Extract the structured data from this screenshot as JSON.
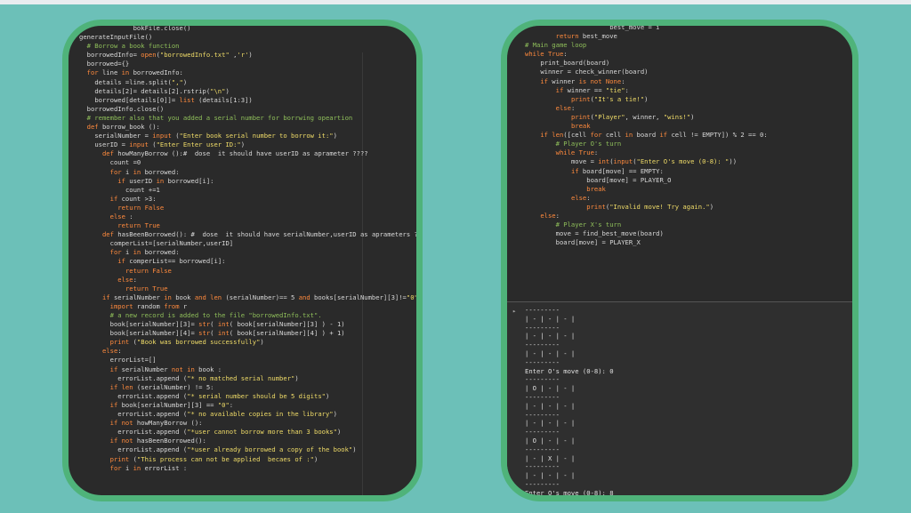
{
  "left_editor": {
    "lines": [
      {
        "t": "              bokFile.close()",
        "c": "code"
      },
      {
        "t": "generateInputFile()",
        "c": "code"
      },
      {
        "t": "",
        "c": "code"
      },
      {
        "t": "",
        "c": "code"
      },
      {
        "t": "  # Borrow a book function",
        "c": "cm"
      },
      {
        "t": "  borrowedInfo= open(\"borrowedInfo.txt\" ,'r')",
        "c": "code"
      },
      {
        "t": "  borrowed={}",
        "c": "code"
      },
      {
        "t": "  for line in borrowedInfo:",
        "c": "code"
      },
      {
        "t": "    details =line.split(\",\")",
        "c": "code"
      },
      {
        "t": "    details[2]= details[2].rstrip(\"\\n\")",
        "c": "code"
      },
      {
        "t": "    borrowed[details[0]]= list (details[1:3])",
        "c": "code"
      },
      {
        "t": "  borrowedInfo.close()",
        "c": "code"
      },
      {
        "t": "",
        "c": "code"
      },
      {
        "t": "  # remember also that you added a serial number for borrwing opeartion",
        "c": "cm"
      },
      {
        "t": "  def borrow_book ():",
        "c": "code"
      },
      {
        "t": "    serialNumber = input (\"Enter book serial number to borrow it:\")",
        "c": "code"
      },
      {
        "t": "    userID = input (\"Enter Enter user ID:\")",
        "c": "code"
      },
      {
        "t": "",
        "c": "code"
      },
      {
        "t": "      def howManyBorrow ():#  dose  it should have userID as aprameter ????",
        "c": "code"
      },
      {
        "t": "        count =0",
        "c": "code"
      },
      {
        "t": "        for i in borrowed:",
        "c": "code"
      },
      {
        "t": "          if userID in borrowed[i]:",
        "c": "code"
      },
      {
        "t": "            count +=1",
        "c": "code"
      },
      {
        "t": "        if count >3:",
        "c": "code"
      },
      {
        "t": "          return False",
        "c": "code"
      },
      {
        "t": "        else :",
        "c": "code"
      },
      {
        "t": "          return True",
        "c": "code"
      },
      {
        "t": "",
        "c": "code"
      },
      {
        "t": "      def hasBeenBorrowed(): #  dose  it should have serialNumber,userID as aprameters ????",
        "c": "code"
      },
      {
        "t": "        comperList=[serialNumber,userID]",
        "c": "code"
      },
      {
        "t": "        for i in borrowed:",
        "c": "code"
      },
      {
        "t": "          if comperList== borrowed[i]:",
        "c": "code"
      },
      {
        "t": "            return False",
        "c": "code"
      },
      {
        "t": "          else:",
        "c": "code"
      },
      {
        "t": "            return True",
        "c": "code"
      },
      {
        "t": "",
        "c": "code"
      },
      {
        "t": "      if serialNumber in book and len (serialNumber)== 5 and books[serialNumber][3]!=\"0\" and howManyBo",
        "c": "code"
      },
      {
        "t": "        import random from r",
        "c": "code"
      },
      {
        "t": "        # a new record is added to the file \"borrowedInfo.txt\".",
        "c": "cm"
      },
      {
        "t": "        book[serialNumber][3]= str( int( book[serialNumber][3] ) - 1)",
        "c": "code"
      },
      {
        "t": "        book[serialNumber][4]= str( int( book[serialNumber][4] ) + 1)",
        "c": "code"
      },
      {
        "t": "        print (\"Book was borrowed successfully\")",
        "c": "code"
      },
      {
        "t": "      else:",
        "c": "code"
      },
      {
        "t": "        errorList=[]",
        "c": "code"
      },
      {
        "t": "        if serialNumber not in book :",
        "c": "code"
      },
      {
        "t": "          errorList.append (\"* no matched serial number\")",
        "c": "code"
      },
      {
        "t": "        if len (serialNumber) != 5:",
        "c": "code"
      },
      {
        "t": "          errorList.append (\"* serial number should be 5 digits\")",
        "c": "code"
      },
      {
        "t": "        if book[serialNumber][3] == \"0\":",
        "c": "code"
      },
      {
        "t": "          errorList.append (\"* no available copies in the library\")",
        "c": "code"
      },
      {
        "t": "        if not howManyBorrow ():",
        "c": "code"
      },
      {
        "t": "          errorList.append (\"*user cannot borrow more than 3 books\")",
        "c": "code"
      },
      {
        "t": "        if not hasBeenBorrowed():",
        "c": "code"
      },
      {
        "t": "          errorList.append (\"*user already borrowed a copy of the book\")",
        "c": "code"
      },
      {
        "t": "        print (\"This process can not be applied  becaes of :\")",
        "c": "code"
      },
      {
        "t": "        for i in errorList :",
        "c": "code"
      }
    ]
  },
  "right_editor": {
    "lines": [
      {
        "t": "                      best_move = i",
        "c": "code"
      },
      {
        "t": "",
        "c": "code"
      },
      {
        "t": "        return best_move",
        "c": "code"
      },
      {
        "t": "",
        "c": "code"
      },
      {
        "t": "# Main game loop",
        "c": "cm"
      },
      {
        "t": "while True:",
        "c": "code"
      },
      {
        "t": "    print_board(board)",
        "c": "code"
      },
      {
        "t": "    winner = check_winner(board)",
        "c": "code"
      },
      {
        "t": "",
        "c": "code"
      },
      {
        "t": "    if winner is not None:",
        "c": "code"
      },
      {
        "t": "        if winner == \"tie\":",
        "c": "code"
      },
      {
        "t": "            print(\"It's a tie!\")",
        "c": "code"
      },
      {
        "t": "        else:",
        "c": "code"
      },
      {
        "t": "            print(\"Player\", winner, \"wins!\")",
        "c": "code"
      },
      {
        "t": "            break",
        "c": "code"
      },
      {
        "t": "",
        "c": "code"
      },
      {
        "t": "    if len([cell for cell in board if cell != EMPTY]) % 2 == 0:",
        "c": "code"
      },
      {
        "t": "        # Player O's turn",
        "c": "cm"
      },
      {
        "t": "        while True:",
        "c": "code"
      },
      {
        "t": "            move = int(input(\"Enter O's move (0-8): \"))",
        "c": "code"
      },
      {
        "t": "            if board[move] == EMPTY:",
        "c": "code"
      },
      {
        "t": "                board[move] = PLAYER_O",
        "c": "code"
      },
      {
        "t": "                break",
        "c": "code"
      },
      {
        "t": "            else:",
        "c": "code"
      },
      {
        "t": "                print(\"Invalid move! Try again.\")",
        "c": "code"
      },
      {
        "t": "    else:",
        "c": "code"
      },
      {
        "t": "        # Player X's turn",
        "c": "cm"
      },
      {
        "t": "        move = find_best_move(board)",
        "c": "code"
      },
      {
        "t": "        board[move] = PLAYER_X",
        "c": "code"
      }
    ]
  },
  "terminal": {
    "lines": [
      "---------",
      "| - | - | - |",
      "---------",
      "| - | - | - |",
      "---------",
      "| - | - | - |",
      "---------",
      "Enter O's move (0-8): 0",
      "---------",
      "| O | - | - |",
      "---------",
      "| - | - | - |",
      "---------",
      "| - | - | - |",
      "---------",
      "| O | - | - |",
      "---------",
      "| - | X | - |",
      "---------",
      "| - | - | - |",
      "---------",
      "Enter O's move (0-8): 8",
      "---------"
    ]
  }
}
